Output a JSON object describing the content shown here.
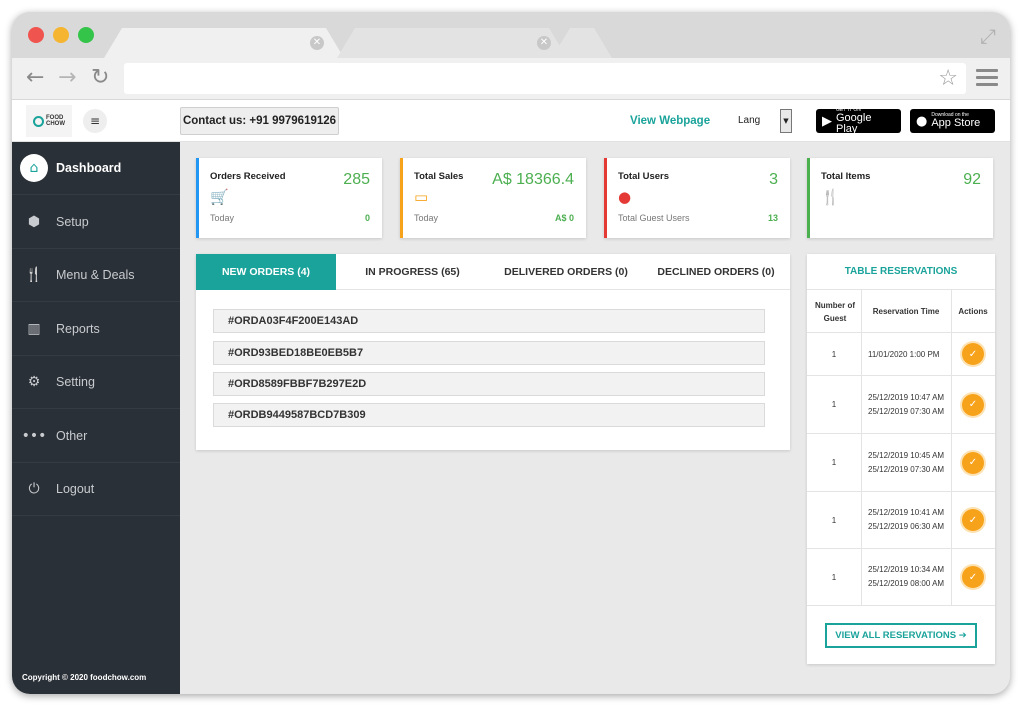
{
  "browser": {
    "tabs": [
      {
        "close_icon": "close-icon"
      },
      {
        "close_icon": "close-icon"
      }
    ],
    "url": "",
    "icons": [
      "back-arrow-icon",
      "forward-arrow-icon",
      "reload-icon",
      "star-icon",
      "menu-icon",
      "resize-icon"
    ]
  },
  "header": {
    "logo_text_top": "FOOD",
    "logo_text_bottom": "CHOW",
    "contact": "Contact us: +91 9979619126",
    "view_webpage": "View Webpage",
    "lang": "Lang",
    "google_play_small": "GET IT ON",
    "google_play": "Google Play",
    "app_store_small": "Download on the",
    "app_store": "App Store"
  },
  "sidebar": {
    "items": [
      {
        "label": "Dashboard",
        "icon": "home-icon",
        "active": true
      },
      {
        "label": "Setup",
        "icon": "cube-icon"
      },
      {
        "label": "Menu & Deals",
        "icon": "utensils-icon"
      },
      {
        "label": "Reports",
        "icon": "bar-chart-icon"
      },
      {
        "label": "Setting",
        "icon": "gear-icon"
      },
      {
        "label": "Other",
        "icon": "ellipsis-icon"
      },
      {
        "label": "Logout",
        "icon": "power-icon"
      }
    ],
    "copyright": "Copyright © 2020 foodchow.com"
  },
  "cards": [
    {
      "title": "Orders Received",
      "value": "285",
      "sub": "Today",
      "sub_value": "0",
      "color": "#2196f3",
      "icon": "cart-icon"
    },
    {
      "title": "Total Sales",
      "value": "A$ 18366.4",
      "sub": "Today",
      "sub_value": "A$ 0",
      "color": "#f7a21b",
      "icon": "credit-card-icon"
    },
    {
      "title": "Total Users",
      "value": "3",
      "sub": "Total Guest Users",
      "sub_value": "13",
      "color": "#e53935",
      "icon": "user-icon"
    },
    {
      "title": "Total Items",
      "value": "92",
      "sub": "",
      "sub_value": "",
      "color": "#4caf50",
      "icon": "utensils-icon"
    }
  ],
  "orders": {
    "tabs": [
      {
        "label": "NEW ORDERS (4)",
        "active": true
      },
      {
        "label": "IN PROGRESS (65)"
      },
      {
        "label": "DELIVERED ORDERS (0)"
      },
      {
        "label": "DECLINED ORDERS (0)"
      }
    ],
    "list": [
      "#ORDA03F4F200E143AD",
      "#ORD93BED18BE0EB5B7",
      "#ORD8589FBBF7B297E2D",
      "#ORDB9449587BCD7B309"
    ]
  },
  "reservations": {
    "title": "TABLE RESERVATIONS",
    "headers": [
      "Number of Guest",
      "Reservation Time",
      "Actions"
    ],
    "rows": [
      {
        "guests": "1",
        "time": "11/01/2020 1:00 PM"
      },
      {
        "guests": "1",
        "time": "25/12/2019 10:47 AM 25/12/2019 07:30 AM"
      },
      {
        "guests": "1",
        "time": "25/12/2019 10:45 AM 25/12/2019 07:30 AM"
      },
      {
        "guests": "1",
        "time": "25/12/2019 10:41 AM 25/12/2019 06:30 AM"
      },
      {
        "guests": "1",
        "time": "25/12/2019 10:34 AM 25/12/2019 08:00 AM"
      }
    ],
    "view_all": "VIEW ALL RESERVATIONS"
  },
  "colors": {
    "accent": "#1aa39a",
    "sidebar": "#2a3037",
    "green": "#4caf50",
    "orange": "#f7a21b"
  }
}
